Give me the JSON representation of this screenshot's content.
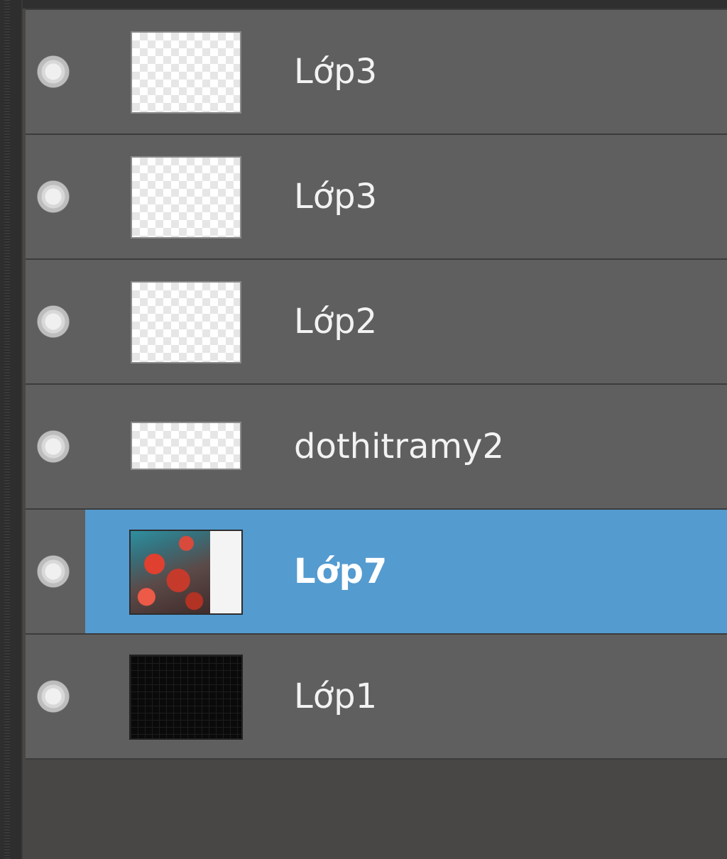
{
  "layers_panel": {
    "layers": [
      {
        "name": "Lớp3",
        "thumb": "transparent",
        "selected": false
      },
      {
        "name": "Lớp3",
        "thumb": "transparent",
        "selected": false
      },
      {
        "name": "Lớp2",
        "thumb": "transparent",
        "selected": false
      },
      {
        "name": "dothitramy2",
        "thumb": "transparent-wide",
        "selected": false
      },
      {
        "name": "Lớp7",
        "thumb": "photo",
        "selected": true
      },
      {
        "name": "Lớp1",
        "thumb": "black",
        "selected": false
      }
    ],
    "colors": {
      "row_bg": "#5f5f5f",
      "selected_bg": "#549bd0",
      "panel_bg": "#494745"
    }
  }
}
